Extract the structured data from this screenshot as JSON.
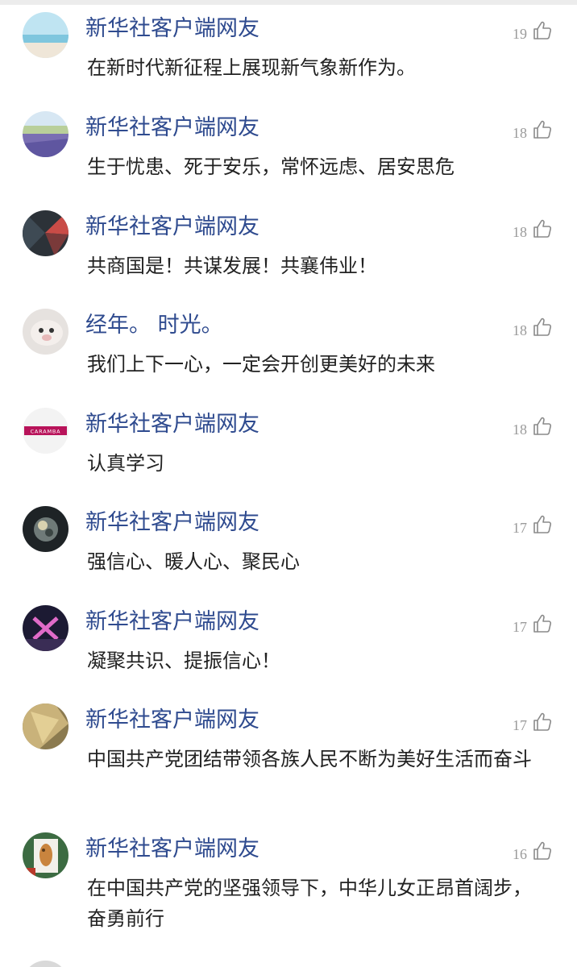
{
  "comments": [
    {
      "user": "新华社客户端网友",
      "text": "在新时代新征程上展现新气象新作为。",
      "likes": "19"
    },
    {
      "user": "新华社客户端网友",
      "text": "生于忧患、死于安乐，常怀远虑、居安思危",
      "likes": "18"
    },
    {
      "user": "新华社客户端网友",
      "text": "共商国是！共谋发展！共襄伟业！",
      "likes": "18"
    },
    {
      "user": "经年。 时光。",
      "text": "我们上下一心，一定会开创更美好的未来",
      "likes": "18"
    },
    {
      "user": "新华社客户端网友",
      "text": "认真学习",
      "likes": "18",
      "avatar_text": "CARAMBA"
    },
    {
      "user": "新华社客户端网友",
      "text": "强信心、暖人心、聚民心",
      "likes": "17"
    },
    {
      "user": "新华社客户端网友",
      "text": "凝聚共识、提振信心！",
      "likes": "17"
    },
    {
      "user": "新华社客户端网友",
      "text": "中国共产党团结带领各族人民不断为美好生活而奋斗",
      "likes": "17"
    },
    {
      "user": "新华社客户端网友",
      "text": "在中国共产党的坚强领导下，中华儿女正昂首阔步，奋勇前行",
      "likes": "16"
    }
  ],
  "colors": {
    "username": "#2f4b8f",
    "text": "#222222",
    "likes": "#9a9a9a"
  },
  "icons": {
    "like": "thumbs-up-icon"
  }
}
